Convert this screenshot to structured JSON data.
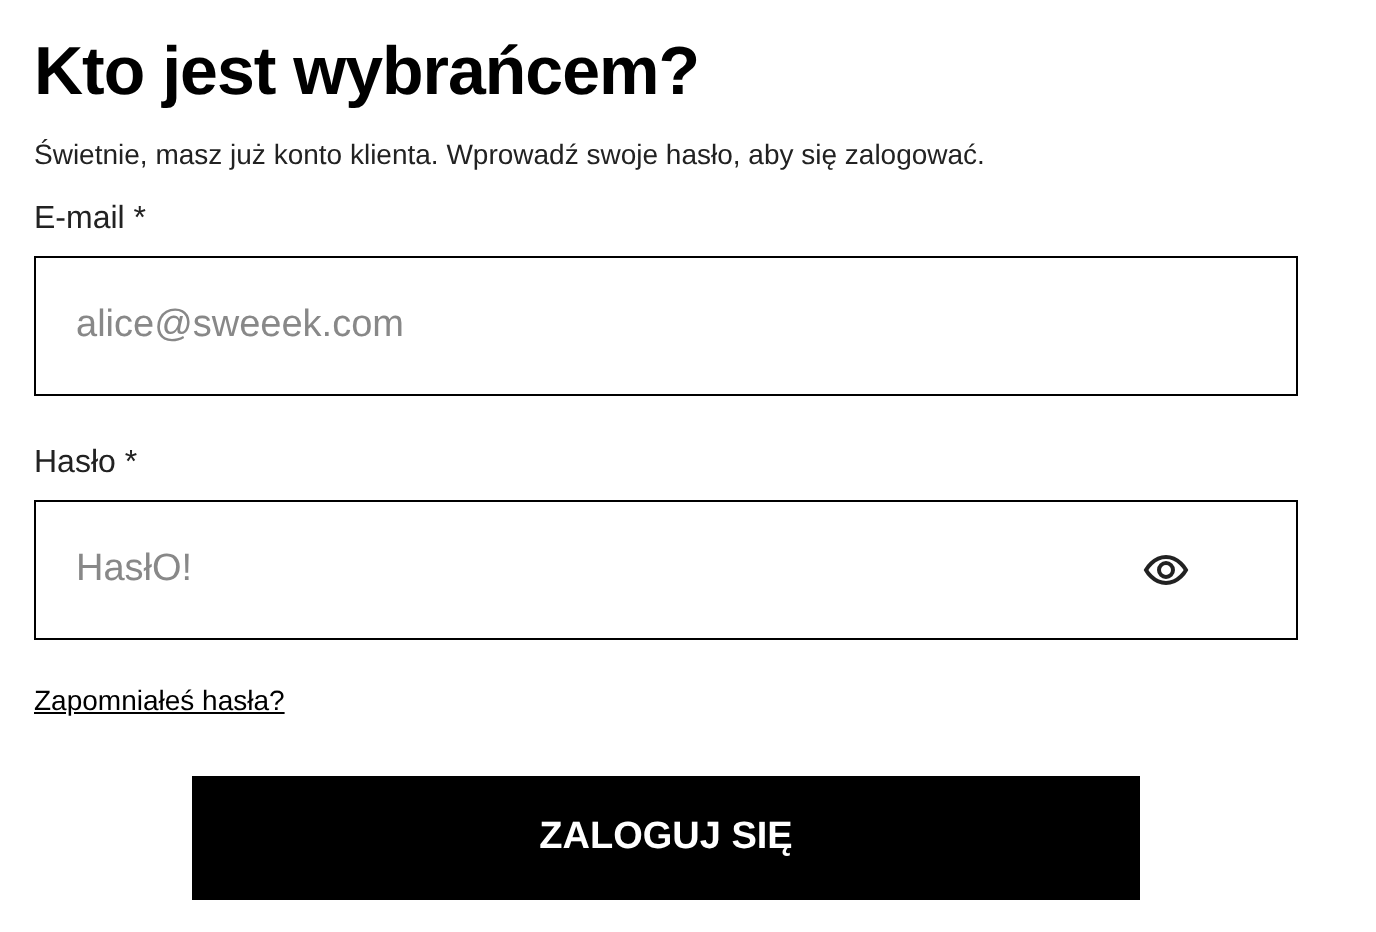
{
  "title": "Kto jest wybrańcem?",
  "subtitle": "Świetnie, masz już konto klienta. Wprowadź swoje hasło, aby się zalogować.",
  "fields": [
    {
      "kind": "email",
      "label": "E-mail *",
      "placeholder": "alice@sweeek.com"
    },
    {
      "kind": "password",
      "label": "Hasło *",
      "placeholder": "HasłO!"
    }
  ],
  "forgot_link": "Zapomniałeś hasła?",
  "submit_button": "ZALOGUJ SIĘ"
}
